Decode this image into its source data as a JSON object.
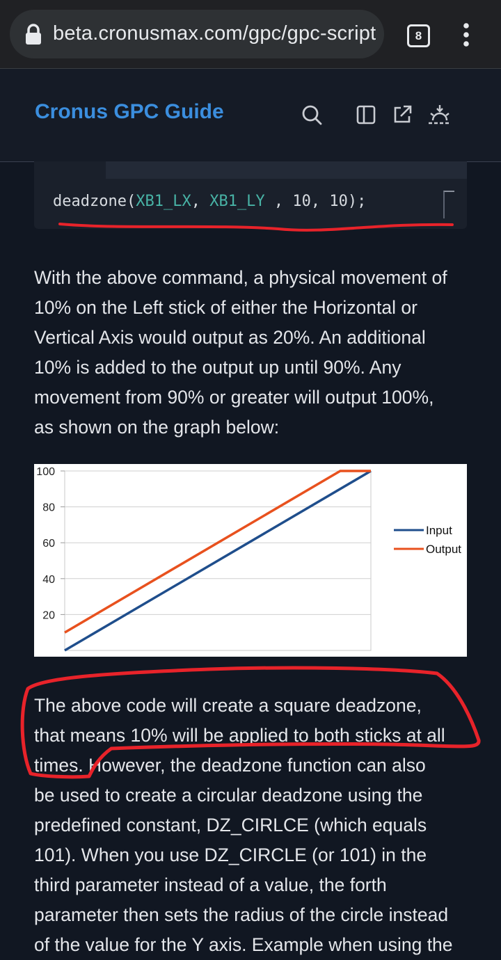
{
  "browser": {
    "url": "beta.cronusmax.com/gpc/gpc-script",
    "tab_count": "8"
  },
  "header": {
    "title": "Cronus GPC Guide",
    "icons": [
      "search-icon",
      "sidebar-icon",
      "external-link-icon",
      "theme-icon"
    ]
  },
  "code": {
    "fn": "deadzone(",
    "arg1": "XB1_LX",
    "sep1": ", ",
    "arg2": "XB1_LY",
    "rest": " , 10, 10);"
  },
  "paragraph1": {
    "lines": [
      "With the above command, a physical movement of",
      "10% on the Left stick of either the Horizontal or",
      "Vertical Axis would output as 20%. An additional",
      "10% is added to the output up until 90%. Any",
      "movement from 90% or greater will output 100%,",
      "as shown on the graph below:"
    ]
  },
  "paragraph2": {
    "lines": [
      "The above code will create a square deadzone,",
      "that means 10% will be applied to both sticks at all",
      "times.  However, the deadzone function can also",
      "be used to create a circular deadzone using the",
      "predefined constant, DZ_CIRLCE (which equals",
      "101). When you use DZ_CIRCLE (or 101) in the",
      "third parameter instead of a value, the forth",
      "parameter then sets the radius of the circle instead",
      "of the value for the Y axis. Example when using the"
    ]
  },
  "colors": {
    "accent": "#3b8ede",
    "annotation": "#e8232a",
    "input_series": "#1f4e8c",
    "output_series": "#e8511e"
  },
  "chart_data": {
    "type": "line",
    "yticks": [
      "20",
      "40",
      "60",
      "80",
      "100"
    ],
    "ylim": [
      0,
      100
    ],
    "xlim": [
      0,
      100
    ],
    "grid": true,
    "legend_position": "right",
    "series": [
      {
        "name": "Input",
        "x": [
          0,
          100
        ],
        "y": [
          0,
          100
        ]
      },
      {
        "name": "Output",
        "x": [
          0,
          90,
          100
        ],
        "y": [
          10,
          100,
          100
        ]
      }
    ]
  }
}
